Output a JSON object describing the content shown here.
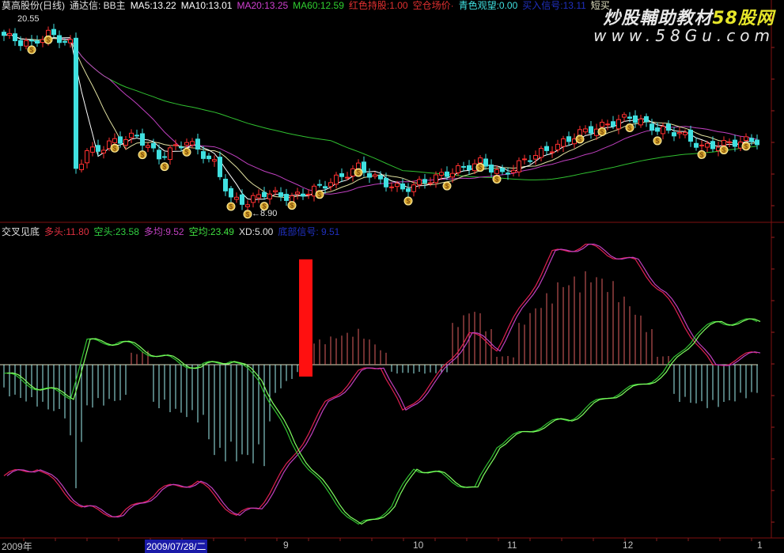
{
  "header": {
    "title": "莫高股份(日线)",
    "formula": "通达信: BB主",
    "items": [
      {
        "text": "MA5:13.22",
        "color": "#ffffff"
      },
      {
        "text": "MA10:13.01",
        "color": "#ffffff"
      },
      {
        "text": "MA20:13.25",
        "color": "#d040d0"
      },
      {
        "text": "MA60:12.59",
        "color": "#30d030"
      },
      {
        "text": "红色持股:1.00",
        "color": "#e03030"
      },
      {
        "text": "空仓场价·",
        "color": "#e03030"
      },
      {
        "text": "青色观望:0.00",
        "color": "#40e0e0"
      },
      {
        "text": "买入信号:13.11",
        "color": "#2030c0"
      },
      {
        "text": "短买",
        "color": "#e0e0c0"
      }
    ]
  },
  "indicator_header": {
    "title": "交叉见底",
    "items": [
      {
        "text": "多头:11.80",
        "color": "#e03040"
      },
      {
        "text": "空头:23.58",
        "color": "#30d040"
      },
      {
        "text": "多均:9.52",
        "color": "#c040c0"
      },
      {
        "text": "空均:23.49",
        "color": "#40e040"
      },
      {
        "text": "XD:5.00",
        "color": "#e0e0e0"
      },
      {
        "text": "底部信号: 9.51",
        "color": "#2030c0"
      }
    ]
  },
  "watermark": {
    "line1": "炒股輔助教材",
    "line1_accent": "58股网",
    "line2": "www.58Gu.com"
  },
  "notes": {
    "high_label": "20.55",
    "low_label": "←8.90"
  },
  "time_axis": [
    "2009年",
    "2009/07/28/二",
    "9",
    "10",
    "11",
    "12",
    "1"
  ],
  "colors": {
    "up": "#ff3030",
    "down": "#40e0e0",
    "bg": "#000000",
    "frame": "#801010"
  },
  "chart_data": {
    "type": "candlestick",
    "bars": 137,
    "close_keypoints": [
      [
        0,
        19.5
      ],
      [
        3,
        19.1
      ],
      [
        5,
        19.0
      ],
      [
        8,
        19.6
      ],
      [
        10,
        19.3
      ],
      [
        12,
        19.0
      ],
      [
        13,
        11.3
      ],
      [
        15,
        12.3
      ],
      [
        18,
        12.6
      ],
      [
        20,
        13.0
      ],
      [
        24,
        13.3
      ],
      [
        28,
        12.0
      ],
      [
        33,
        13.0
      ],
      [
        38,
        11.6
      ],
      [
        41,
        9.4
      ],
      [
        44,
        9.2
      ],
      [
        47,
        9.8
      ],
      [
        52,
        9.5
      ],
      [
        56,
        10.0
      ],
      [
        61,
        10.8
      ],
      [
        64,
        11.4
      ],
      [
        68,
        10.5
      ],
      [
        72,
        10.0
      ],
      [
        76,
        10.5
      ],
      [
        80,
        11.0
      ],
      [
        86,
        11.7
      ],
      [
        90,
        10.9
      ],
      [
        95,
        12.0
      ],
      [
        100,
        12.7
      ],
      [
        104,
        13.5
      ],
      [
        108,
        13.9
      ],
      [
        113,
        14.5
      ],
      [
        118,
        13.7
      ],
      [
        122,
        13.5
      ],
      [
        126,
        12.6
      ],
      [
        130,
        12.8
      ],
      [
        134,
        13.0
      ],
      [
        136,
        13.0
      ]
    ],
    "signal_bars": [
      5,
      8,
      20,
      25,
      29,
      33,
      41,
      44,
      47,
      52,
      57,
      64,
      73,
      80,
      86,
      89,
      104,
      108,
      113,
      118,
      126,
      130,
      134
    ],
    "indicator": {
      "duotou_keypoints": [
        [
          0,
          -39
        ],
        [
          6,
          -36
        ],
        [
          14,
          -50
        ],
        [
          21,
          -53
        ],
        [
          28,
          -44
        ],
        [
          35,
          -41
        ],
        [
          42,
          -53
        ],
        [
          46,
          -50
        ],
        [
          52,
          -33
        ],
        [
          58,
          -14
        ],
        [
          64,
          -3
        ],
        [
          68,
          0
        ],
        [
          72,
          -17
        ],
        [
          78,
          -5
        ],
        [
          84,
          11
        ],
        [
          89,
          6
        ],
        [
          94,
          22
        ],
        [
          99,
          39
        ],
        [
          105,
          42
        ],
        [
          109,
          39
        ],
        [
          114,
          36
        ],
        [
          119,
          25
        ],
        [
          125,
          8
        ],
        [
          128,
          -1
        ],
        [
          132,
          2
        ],
        [
          136,
          4
        ]
      ],
      "kongtou_keypoints": [
        [
          0,
          -3
        ],
        [
          6,
          -8
        ],
        [
          12,
          -11
        ],
        [
          15,
          8
        ],
        [
          21,
          8
        ],
        [
          28,
          3
        ],
        [
          35,
          -1
        ],
        [
          41,
          2
        ],
        [
          46,
          -5
        ],
        [
          52,
          -28
        ],
        [
          58,
          -44
        ],
        [
          64,
          -57
        ],
        [
          70,
          -50
        ],
        [
          74,
          -36
        ],
        [
          79,
          -39
        ],
        [
          85,
          -44
        ],
        [
          89,
          -28
        ],
        [
          96,
          -22
        ],
        [
          102,
          -19
        ],
        [
          109,
          -11
        ],
        [
          114,
          -8
        ],
        [
          119,
          -3
        ],
        [
          125,
          11
        ],
        [
          129,
          15
        ],
        [
          136,
          15
        ]
      ],
      "histogram_keypoints": [
        [
          0,
          -10
        ],
        [
          6,
          -14
        ],
        [
          11,
          -18
        ],
        [
          13,
          -42
        ],
        [
          15,
          -15
        ],
        [
          22,
          -12
        ],
        [
          23,
          4
        ],
        [
          26,
          5
        ],
        [
          27,
          -14
        ],
        [
          36,
          -20
        ],
        [
          38,
          -32
        ],
        [
          47,
          -34
        ],
        [
          49,
          -10
        ],
        [
          53,
          -3
        ],
        [
          56,
          8
        ],
        [
          64,
          12
        ],
        [
          69,
          4
        ],
        [
          70,
          -3
        ],
        [
          80,
          -3
        ],
        [
          81,
          14
        ],
        [
          85,
          20
        ],
        [
          88,
          12
        ],
        [
          89,
          3
        ],
        [
          92,
          3
        ],
        [
          93,
          14
        ],
        [
          100,
          28
        ],
        [
          106,
          32
        ],
        [
          110,
          28
        ],
        [
          117,
          12
        ],
        [
          118,
          3
        ],
        [
          120,
          3
        ],
        [
          121,
          -12
        ],
        [
          128,
          -15
        ],
        [
          136,
          -10
        ]
      ],
      "signal_bar": {
        "index": 54,
        "value": 37
      },
      "zero_line": 0
    }
  }
}
